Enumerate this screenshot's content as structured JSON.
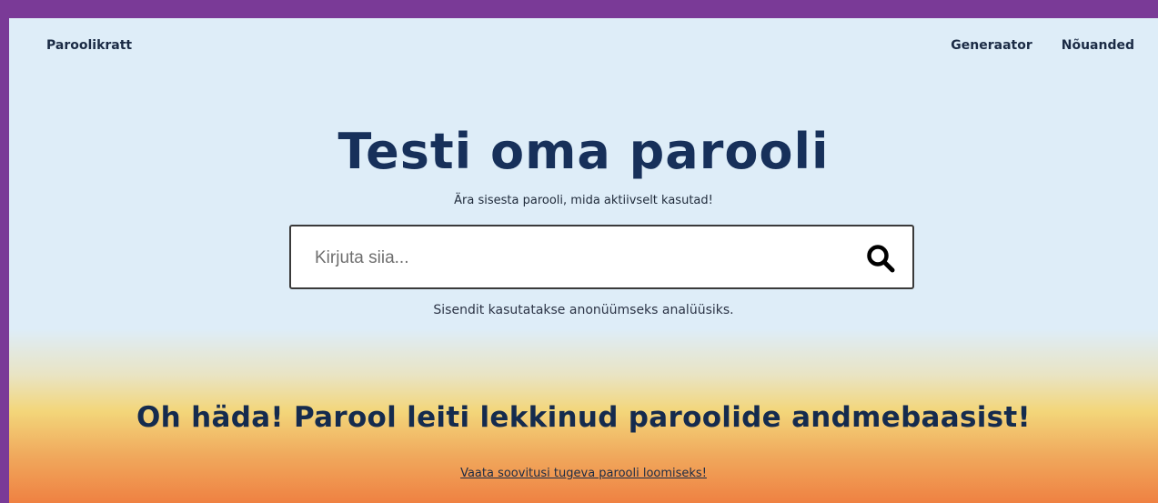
{
  "nav": {
    "brand": "Paroolikratt",
    "links": [
      "Generaator",
      "Nõuanded"
    ]
  },
  "hero": {
    "title": "Testi oma parooli",
    "subtitle": "Ära sisesta parooli, mida aktiivselt kasutad!"
  },
  "search": {
    "placeholder": "Kirjuta siia...",
    "value": "",
    "icon": "search-icon",
    "hint": "Sisendit kasutatakse anonüümseks analüüsiks."
  },
  "result": {
    "title": "Oh häda! Parool leiti lekkinud paroolide andmebaasist!",
    "link": "Vaata soovitusi tugeva parooli loomiseks!"
  },
  "colors": {
    "outer_border": "#7a3a97",
    "background": "#deedf8",
    "heading": "#17305a",
    "gradient_yellow": "#f3d67a",
    "gradient_orange": "#ef8142"
  }
}
